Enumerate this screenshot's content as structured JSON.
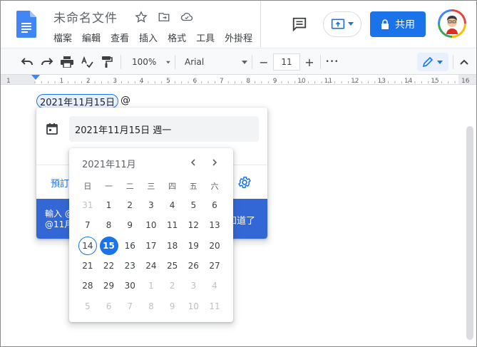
{
  "header": {
    "doc_title": "未命名文件",
    "menu": [
      "檔案",
      "編輯",
      "查看",
      "插入",
      "格式",
      "工具",
      "外掛程"
    ],
    "share_label": "共用"
  },
  "toolbar": {
    "zoom": "100%",
    "font": "Arial",
    "font_size": "11",
    "minus": "−",
    "plus": "+",
    "more": "•••"
  },
  "ruler": {
    "left_labels": [
      "1",
      "1",
      "2",
      "3",
      "4",
      "5",
      "6",
      "7",
      "8",
      "9",
      "10",
      "11",
      "12",
      "13",
      "14",
      "15"
    ],
    "end_label": "16"
  },
  "document": {
    "date_chip": "2021年11月15日",
    "at_sign": "@"
  },
  "date_popup": {
    "date_value": "2021年11月15日 週一",
    "default_link": "預訂",
    "tip_line1": "輸入 @",
    "tip_line2": "@11月",
    "got_it": "知道了"
  },
  "calendar": {
    "title": "2021年11月",
    "weekdays": [
      "日",
      "一",
      "二",
      "三",
      "四",
      "五",
      "六"
    ],
    "today": "14",
    "selected": "15",
    "weeks": [
      [
        {
          "d": "31",
          "o": true
        },
        {
          "d": "1"
        },
        {
          "d": "2"
        },
        {
          "d": "3"
        },
        {
          "d": "4"
        },
        {
          "d": "5"
        },
        {
          "d": "6"
        }
      ],
      [
        {
          "d": "7"
        },
        {
          "d": "8"
        },
        {
          "d": "9"
        },
        {
          "d": "10"
        },
        {
          "d": "11"
        },
        {
          "d": "12"
        },
        {
          "d": "13"
        }
      ],
      [
        {
          "d": "14"
        },
        {
          "d": "15"
        },
        {
          "d": "16"
        },
        {
          "d": "17"
        },
        {
          "d": "18"
        },
        {
          "d": "19"
        },
        {
          "d": "20"
        }
      ],
      [
        {
          "d": "21"
        },
        {
          "d": "22"
        },
        {
          "d": "23"
        },
        {
          "d": "24"
        },
        {
          "d": "25"
        },
        {
          "d": "26"
        },
        {
          "d": "27"
        }
      ],
      [
        {
          "d": "28"
        },
        {
          "d": "29"
        },
        {
          "d": "30"
        },
        {
          "d": "1",
          "o": true
        },
        {
          "d": "2",
          "o": true
        },
        {
          "d": "3",
          "o": true
        },
        {
          "d": "4",
          "o": true
        }
      ],
      [
        {
          "d": "5",
          "o": true
        },
        {
          "d": "6",
          "o": true
        },
        {
          "d": "7",
          "o": true
        },
        {
          "d": "8",
          "o": true
        },
        {
          "d": "9",
          "o": true
        },
        {
          "d": "10",
          "o": true
        },
        {
          "d": "11",
          "o": true
        }
      ]
    ]
  },
  "colors": {
    "accent": "#1a73e8",
    "tip_bar": "#3367d6"
  }
}
